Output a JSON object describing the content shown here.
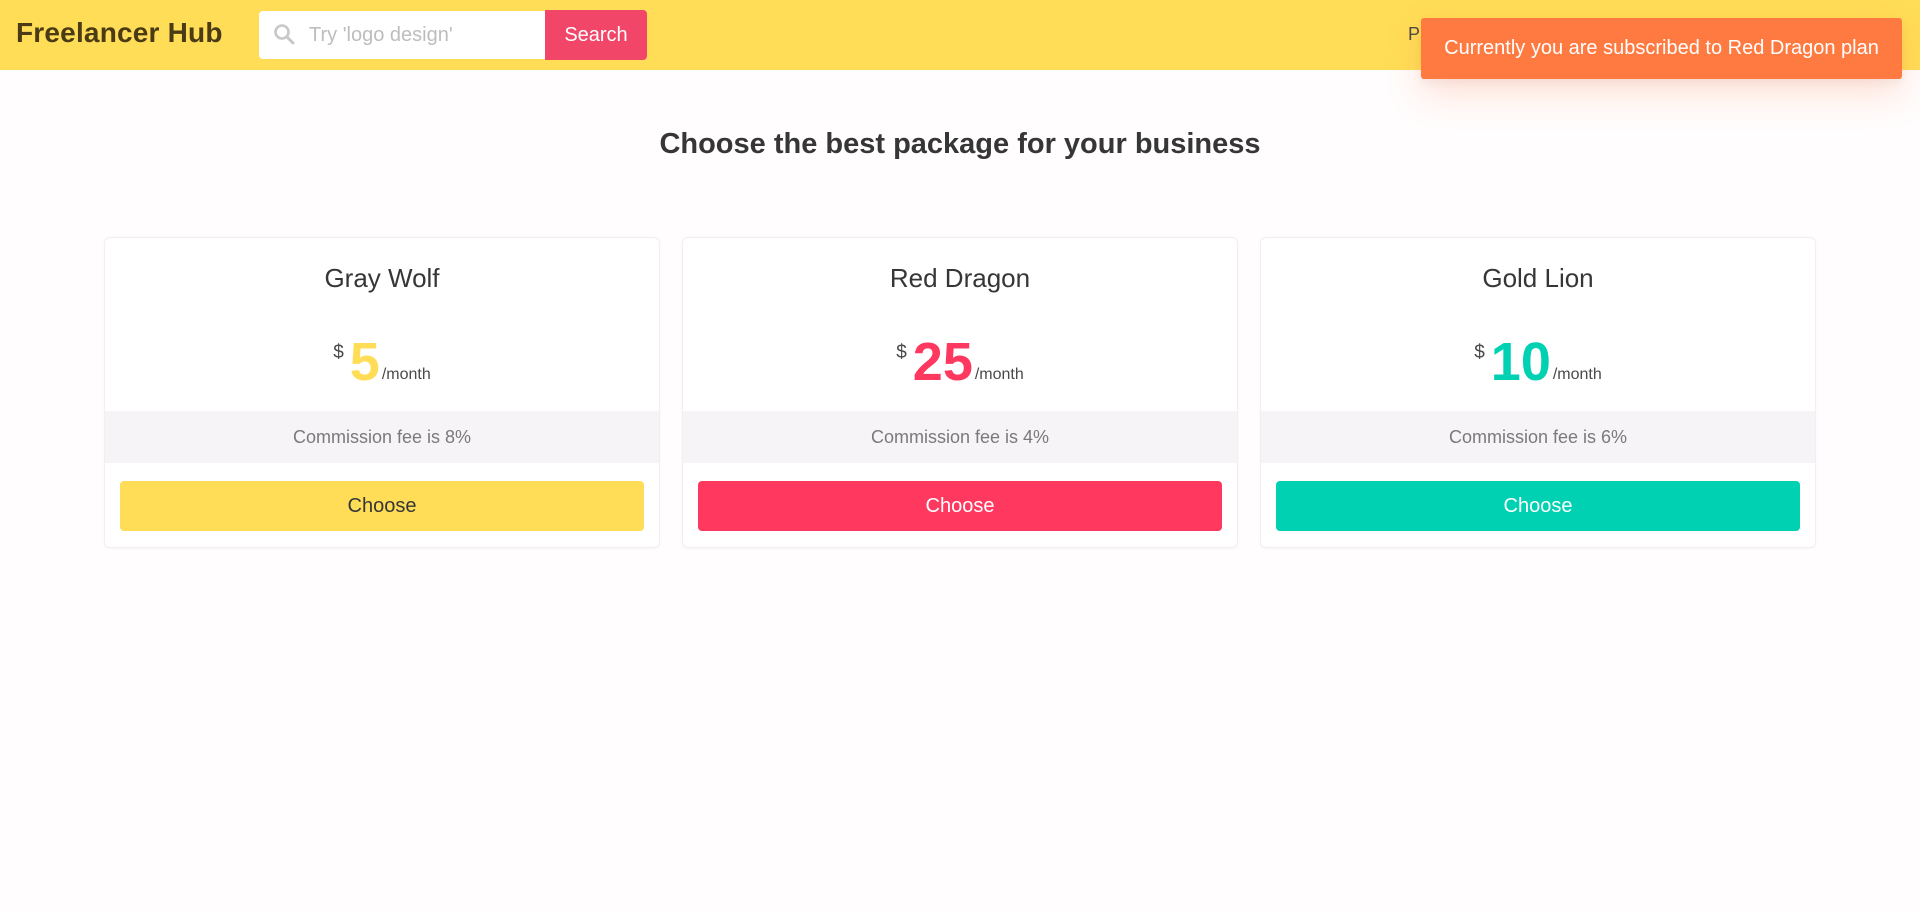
{
  "navbar": {
    "brand": "Freelancer Hub",
    "search": {
      "placeholder": "Try 'logo design'",
      "value": "",
      "button_label": "Search",
      "icon": "search-icon"
    },
    "partial_item_text": "P"
  },
  "toast": {
    "message": "Currently you are subscribed to Red Dragon plan"
  },
  "main": {
    "title": "Choose the best package for your business"
  },
  "plans": [
    {
      "name": "Gray Wolf",
      "currency": "$",
      "price": "5",
      "period": "/month",
      "commission": "Commission fee is 8%",
      "button_label": "Choose",
      "color": "#ffdd57",
      "button_text_color": "#363636"
    },
    {
      "name": "Red Dragon",
      "currency": "$",
      "price": "25",
      "period": "/month",
      "commission": "Commission fee is 4%",
      "button_label": "Choose",
      "color": "#ff3860",
      "button_text_color": "#ffffff"
    },
    {
      "name": "Gold Lion",
      "currency": "$",
      "price": "10",
      "period": "/month",
      "commission": "Commission fee is 6%",
      "button_label": "Choose",
      "color": "#00d1b2",
      "button_text_color": "#ffffff"
    }
  ],
  "colors": {
    "navbar_bg": "#ffdd57",
    "search_button_bg": "#f14668",
    "toast_bg": "#ff7a40",
    "commission_bg": "#f6f4f6"
  }
}
